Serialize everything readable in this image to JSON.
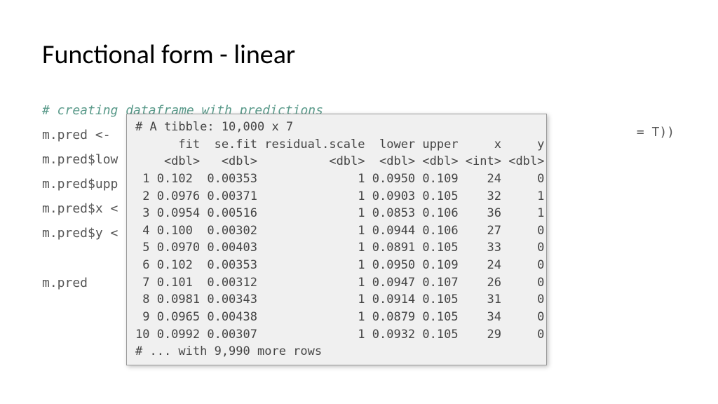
{
  "title": "Functional form - linear",
  "bg_code": {
    "comment": "# creating dataframe with predictions",
    "l1": "m.pred <- ",
    "l2": "m.pred$low",
    "l3": "m.pred$upp",
    "l4": "m.pred$x <",
    "l5": "m.pred$y <",
    "l6": "",
    "l7": "m.pred"
  },
  "right_frag": "= T))",
  "tibble": {
    "header": "# A tibble: 10,000 x 7",
    "col_hdr": "      fit  se.fit residual.scale  lower upper     x     y",
    "col_type": "    <dbl>   <dbl>          <dbl>  <dbl> <dbl> <int> <dbl>",
    "r1": " 1 0.102  0.00353              1 0.0950 0.109    24     0",
    "r2": " 2 0.0976 0.00371              1 0.0903 0.105    32     1",
    "r3": " 3 0.0954 0.00516              1 0.0853 0.106    36     1",
    "r4": " 4 0.100  0.00302              1 0.0944 0.106    27     0",
    "r5": " 5 0.0970 0.00403              1 0.0891 0.105    33     0",
    "r6": " 6 0.102  0.00353              1 0.0950 0.109    24     0",
    "r7": " 7 0.101  0.00312              1 0.0947 0.107    26     0",
    "r8": " 8 0.0981 0.00343              1 0.0914 0.105    31     0",
    "r9": " 9 0.0965 0.00438              1 0.0879 0.105    34     0",
    "r10": "10 0.0992 0.00307              1 0.0932 0.105    29     0",
    "footer": "# ... with 9,990 more rows"
  },
  "chart_data": {
    "type": "table",
    "title": "A tibble: 10,000 x 7",
    "columns": [
      "fit",
      "se.fit",
      "residual.scale",
      "lower",
      "upper",
      "x",
      "y"
    ],
    "column_types": [
      "dbl",
      "dbl",
      "dbl",
      "dbl",
      "dbl",
      "int",
      "dbl"
    ],
    "rows": [
      [
        0.102,
        0.00353,
        1,
        0.095,
        0.109,
        24,
        0
      ],
      [
        0.0976,
        0.00371,
        1,
        0.0903,
        0.105,
        32,
        1
      ],
      [
        0.0954,
        0.00516,
        1,
        0.0853,
        0.106,
        36,
        1
      ],
      [
        0.1,
        0.00302,
        1,
        0.0944,
        0.106,
        27,
        0
      ],
      [
        0.097,
        0.00403,
        1,
        0.0891,
        0.105,
        33,
        0
      ],
      [
        0.102,
        0.00353,
        1,
        0.095,
        0.109,
        24,
        0
      ],
      [
        0.101,
        0.00312,
        1,
        0.0947,
        0.107,
        26,
        0
      ],
      [
        0.0981,
        0.00343,
        1,
        0.0914,
        0.105,
        31,
        0
      ],
      [
        0.0965,
        0.00438,
        1,
        0.0879,
        0.105,
        34,
        0
      ],
      [
        0.0992,
        0.00307,
        1,
        0.0932,
        0.105,
        29,
        0
      ]
    ],
    "more_rows_note": "... with 9,990 more rows"
  }
}
